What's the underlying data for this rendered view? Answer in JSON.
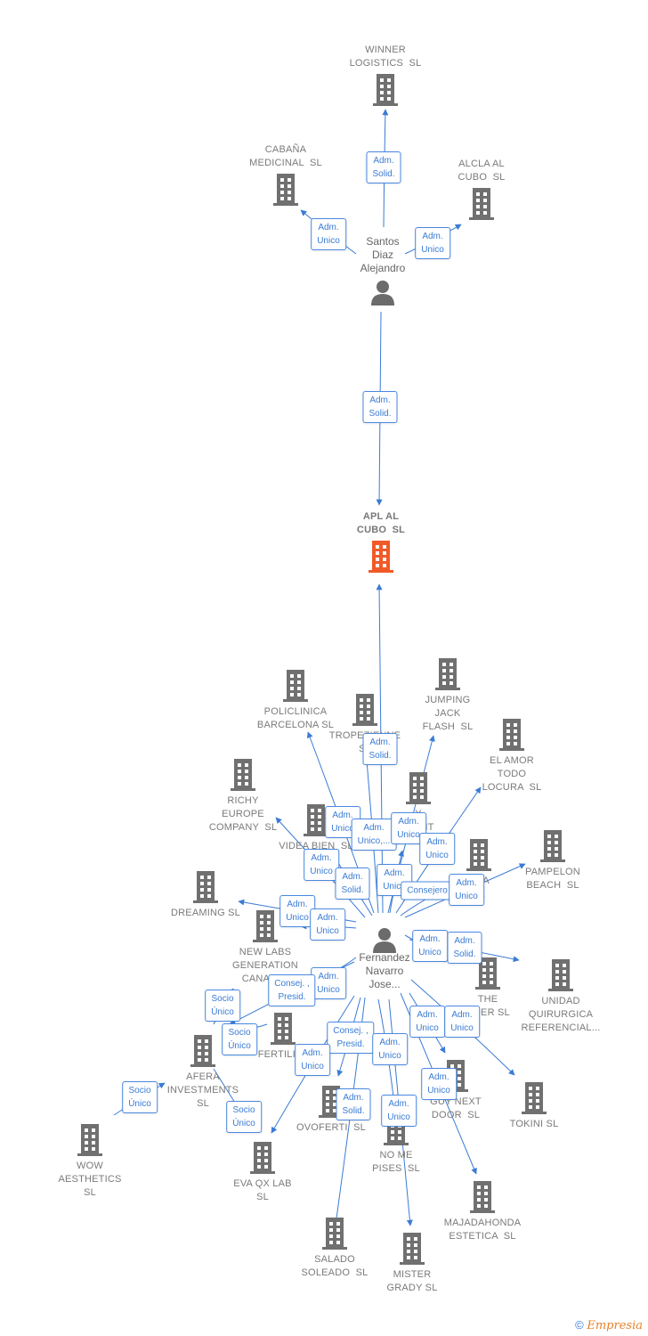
{
  "nodes": [
    {
      "id": "winner",
      "type": "company",
      "label": "WINNER\nLOGISTICS  SL"
    },
    {
      "id": "cabana",
      "type": "company",
      "label": "CABAÑA\nMEDICINAL  SL"
    },
    {
      "id": "alcla",
      "type": "company",
      "label": "ALCLA AL\nCUBO  SL"
    },
    {
      "id": "santos",
      "type": "person",
      "label": "Santos\nDiaz\nAlejandro"
    },
    {
      "id": "apl",
      "type": "main",
      "label": "APL AL\nCUBO  SL"
    },
    {
      "id": "policlinica",
      "type": "company",
      "label": "POLICLINICA\nBARCELONA SL"
    },
    {
      "id": "tropezienne",
      "type": "company",
      "label": "TROPEZIENNE\nSL"
    },
    {
      "id": "jumping",
      "type": "company",
      "label": "JUMPING\nJACK\nFLASH  SL"
    },
    {
      "id": "elamor",
      "type": "company",
      "label": "EL AMOR\nTODO\nLOCURA  SL"
    },
    {
      "id": "richy",
      "type": "company",
      "label": "RICHY\nEUROPE\nCOMPANY  SL"
    },
    {
      "id": "videa",
      "type": "company",
      "label": "VIDEA BIEN  SL"
    },
    {
      "id": "iment",
      "type": "company",
      "label": "Y\nIMENT\nS"
    },
    {
      "id": "mya",
      "type": "company",
      "label": "MYA\nSL"
    },
    {
      "id": "pampelon",
      "type": "company",
      "label": "PAMPELON\nBEACH  SL"
    },
    {
      "id": "dreaming",
      "type": "company",
      "label": "DREAMING SL"
    },
    {
      "id": "newlabs",
      "type": "company",
      "label": "NEW LABS\nGENERATION\nCANARI..."
    },
    {
      "id": "fernandez",
      "type": "person",
      "label": "Fernandez\nNavarro\nJose..."
    },
    {
      "id": "theoder",
      "type": "company",
      "label": "THE\nODER SL"
    },
    {
      "id": "unidad",
      "type": "company",
      "label": "UNIDAD\nQUIRURGICA\nREFERENCIAL..."
    },
    {
      "id": "fertility",
      "type": "company",
      "label": "FERTILITY"
    },
    {
      "id": "afera",
      "type": "company",
      "label": "AFERA\nINVESTMENTS\nSL"
    },
    {
      "id": "guy",
      "type": "company",
      "label": "GUY NEXT\nDOOR  SL"
    },
    {
      "id": "tokini",
      "type": "company",
      "label": "TOKINI SL"
    },
    {
      "id": "ovoferti",
      "type": "company",
      "label": "OVOFERTI  SL"
    },
    {
      "id": "nomepises",
      "type": "company",
      "label": "NO ME\nPISES  SL"
    },
    {
      "id": "wow",
      "type": "company",
      "label": "WOW\nAESTHETICS\nSL"
    },
    {
      "id": "evaqx",
      "type": "company",
      "label": "EVA QX LAB\nSL"
    },
    {
      "id": "majadahonda",
      "type": "company",
      "label": "MAJADAHONDA\nESTETICA  SL"
    },
    {
      "id": "salado",
      "type": "company",
      "label": "SALADO\nSOLEADO  SL"
    },
    {
      "id": "mister",
      "type": "company",
      "label": "MISTER\nGRADY SL"
    }
  ],
  "edges": [
    {
      "from": "santos",
      "to": "winner",
      "role": "Adm.\nSolid."
    },
    {
      "from": "santos",
      "to": "cabana",
      "role": "Adm.\nUnico"
    },
    {
      "from": "santos",
      "to": "alcla",
      "role": "Adm.\nUnico"
    },
    {
      "from": "santos",
      "to": "apl",
      "role": "Adm.\nSolid."
    },
    {
      "from": "fernandez",
      "to": "apl",
      "role": "Adm.\nSolid."
    },
    {
      "from": "fernandez",
      "to": "policlinica",
      "role": "Adm.\nUnico"
    },
    {
      "from": "fernandez",
      "to": "tropezienne",
      "role": "Adm.\nUnico,..."
    },
    {
      "from": "fernandez",
      "to": "jumping",
      "role": "Adm.\nUnico"
    },
    {
      "from": "fernandez",
      "to": "elamor",
      "role": "Adm.\nUnico"
    },
    {
      "from": "fernandez",
      "to": "richy",
      "role": "Adm.\nUnico"
    },
    {
      "from": "fernandez",
      "to": "videa",
      "role": "Adm.\nSolid."
    },
    {
      "from": "fernandez",
      "to": "iment",
      "role": "Adm.\nUnico"
    },
    {
      "from": "fernandez",
      "to": "mya",
      "role": "Consejero"
    },
    {
      "from": "fernandez",
      "to": "pampelon",
      "role": "Adm.\nUnico"
    },
    {
      "from": "fernandez",
      "to": "dreaming",
      "role": "Adm.\nUnico"
    },
    {
      "from": "fernandez",
      "to": "newlabs",
      "role": "Adm.\nUnico"
    },
    {
      "from": "fernandez",
      "to": "theoder",
      "role": "Adm.\nUnico"
    },
    {
      "from": "fernandez",
      "to": "unidad",
      "role": "Adm.\nSolid."
    },
    {
      "from": "fernandez",
      "to": "fertility",
      "role": "Adm.\nUnico"
    },
    {
      "from": "fernandez",
      "to": "afera",
      "role": "Consej. ,\nPresid."
    },
    {
      "from": "afera",
      "to": "newlabs",
      "role": "Socio\nÚnico"
    },
    {
      "from": "fertility",
      "to": "afera",
      "role": "Socio\nÚnico"
    },
    {
      "from": "wow",
      "to": "afera",
      "role": "Socio\nÚnico"
    },
    {
      "from": "afera",
      "to": "evaqx",
      "role": "Socio\nÚnico"
    },
    {
      "from": "fernandez",
      "to": "ovoferti",
      "role": "Consej. ,\nPresid."
    },
    {
      "from": "fernandez",
      "to": "evaqx",
      "role": "Adm.\nUnico"
    },
    {
      "from": "fernandez",
      "to": "salado",
      "role": "Adm.\nSolid."
    },
    {
      "from": "fernandez",
      "to": "nomepises",
      "role": "Adm.\nUnico"
    },
    {
      "from": "fernandez",
      "to": "mister",
      "role": "Adm.\nUnico"
    },
    {
      "from": "fernandez",
      "to": "guy",
      "role": "Adm.\nUnico"
    },
    {
      "from": "fernandez",
      "to": "tokini",
      "role": "Adm.\nUnico"
    },
    {
      "from": "fernandez",
      "to": "majadahonda",
      "role": "Adm.\nUnico"
    }
  ],
  "colors": {
    "edge": "#3a7bd5",
    "company_icon": "#707070",
    "main_icon": "#f05a28",
    "person_icon": "#6b6b6b"
  },
  "footer": {
    "copyright": "©",
    "brand": "Empresia"
  }
}
